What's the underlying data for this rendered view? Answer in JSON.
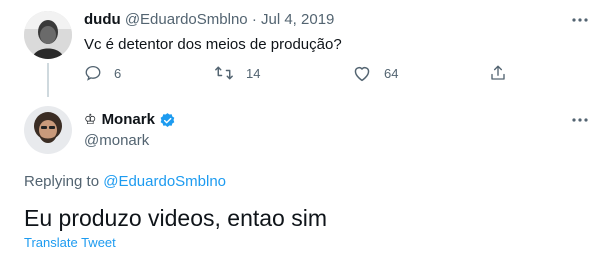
{
  "parent_tweet": {
    "display_name": "dudu",
    "handle": "@EduardoSmblno",
    "separator": "·",
    "date": "Jul 4, 2019",
    "text": "Vc é detentor dos meios de produção?",
    "avatar_icon": "person-avatar",
    "more_icon": "more-dots-icon",
    "actions": {
      "reply": {
        "icon": "reply-icon",
        "count": "6"
      },
      "retweet": {
        "icon": "retweet-icon",
        "count": "14"
      },
      "like": {
        "icon": "heart-icon",
        "count": "64"
      },
      "share": {
        "icon": "share-icon"
      }
    }
  },
  "main_tweet": {
    "display_name": "Monark",
    "name_emoji": "♔",
    "verified_icon": "verified-badge-icon",
    "handle": "@monark",
    "more_icon": "more-dots-icon",
    "replying_prefix": "Replying to",
    "replying_handle": "@EduardoSmblno",
    "text": "Eu produzo videos, entao sim",
    "translate_label": "Translate Tweet"
  },
  "colors": {
    "accent": "#1d9bf0",
    "text": "#0f1419",
    "muted": "#536471",
    "thread_line": "#cfd9de"
  }
}
